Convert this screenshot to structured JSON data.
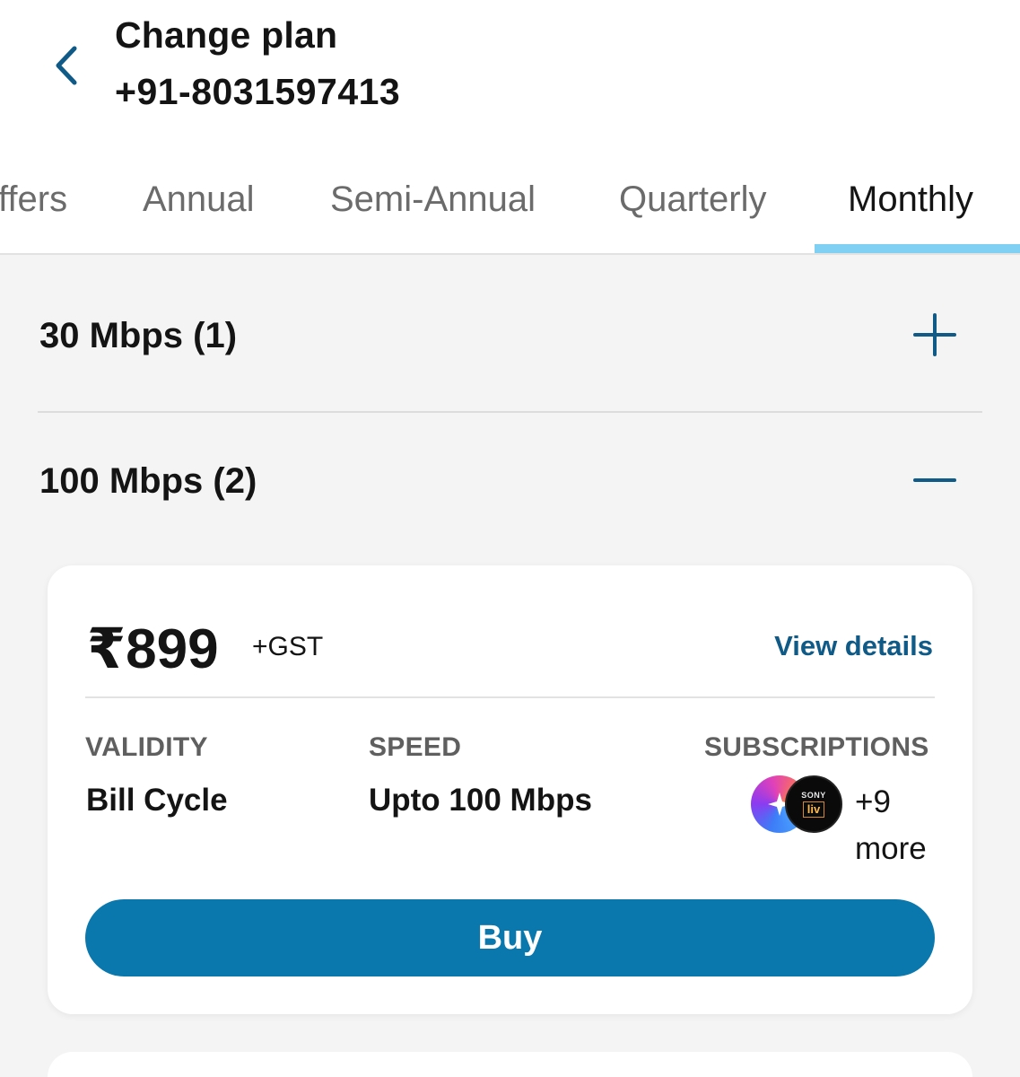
{
  "header": {
    "title": "Change plan",
    "phone": "+91-8031597413",
    "back_icon": "chevron-left-icon"
  },
  "tabs": [
    {
      "label": "Offers",
      "visible_label": "ffers",
      "active": false
    },
    {
      "label": "Annual",
      "active": false
    },
    {
      "label": "Semi-Annual",
      "active": false
    },
    {
      "label": "Quarterly",
      "active": false
    },
    {
      "label": "Monthly",
      "active": true
    }
  ],
  "sections": [
    {
      "label": "30 Mbps (1)",
      "expanded": false,
      "toggle_icon": "plus-icon"
    },
    {
      "label": "100 Mbps (2)",
      "expanded": true,
      "toggle_icon": "minus-icon"
    }
  ],
  "plan_card": {
    "price": "₹899",
    "tax_note": "+GST",
    "view_details": "View details",
    "validity_label": "VALIDITY",
    "validity_value": "Bill Cycle",
    "speed_label": "SPEED",
    "speed_value": "Upto 100 Mbps",
    "subscriptions_label": "SUBSCRIPTIONS",
    "subscription_icons": [
      "jiohotstar-icon",
      "sonyliv-icon"
    ],
    "sony_text": "SONY",
    "liv_text": "liv",
    "more_line1": "+9",
    "more_line2": "more",
    "buy_label": "Buy"
  },
  "colors": {
    "accent": "#0a78ad",
    "link": "#0f5a86",
    "tab_indicator": "#7fd0f2",
    "background": "#f4f4f4"
  }
}
